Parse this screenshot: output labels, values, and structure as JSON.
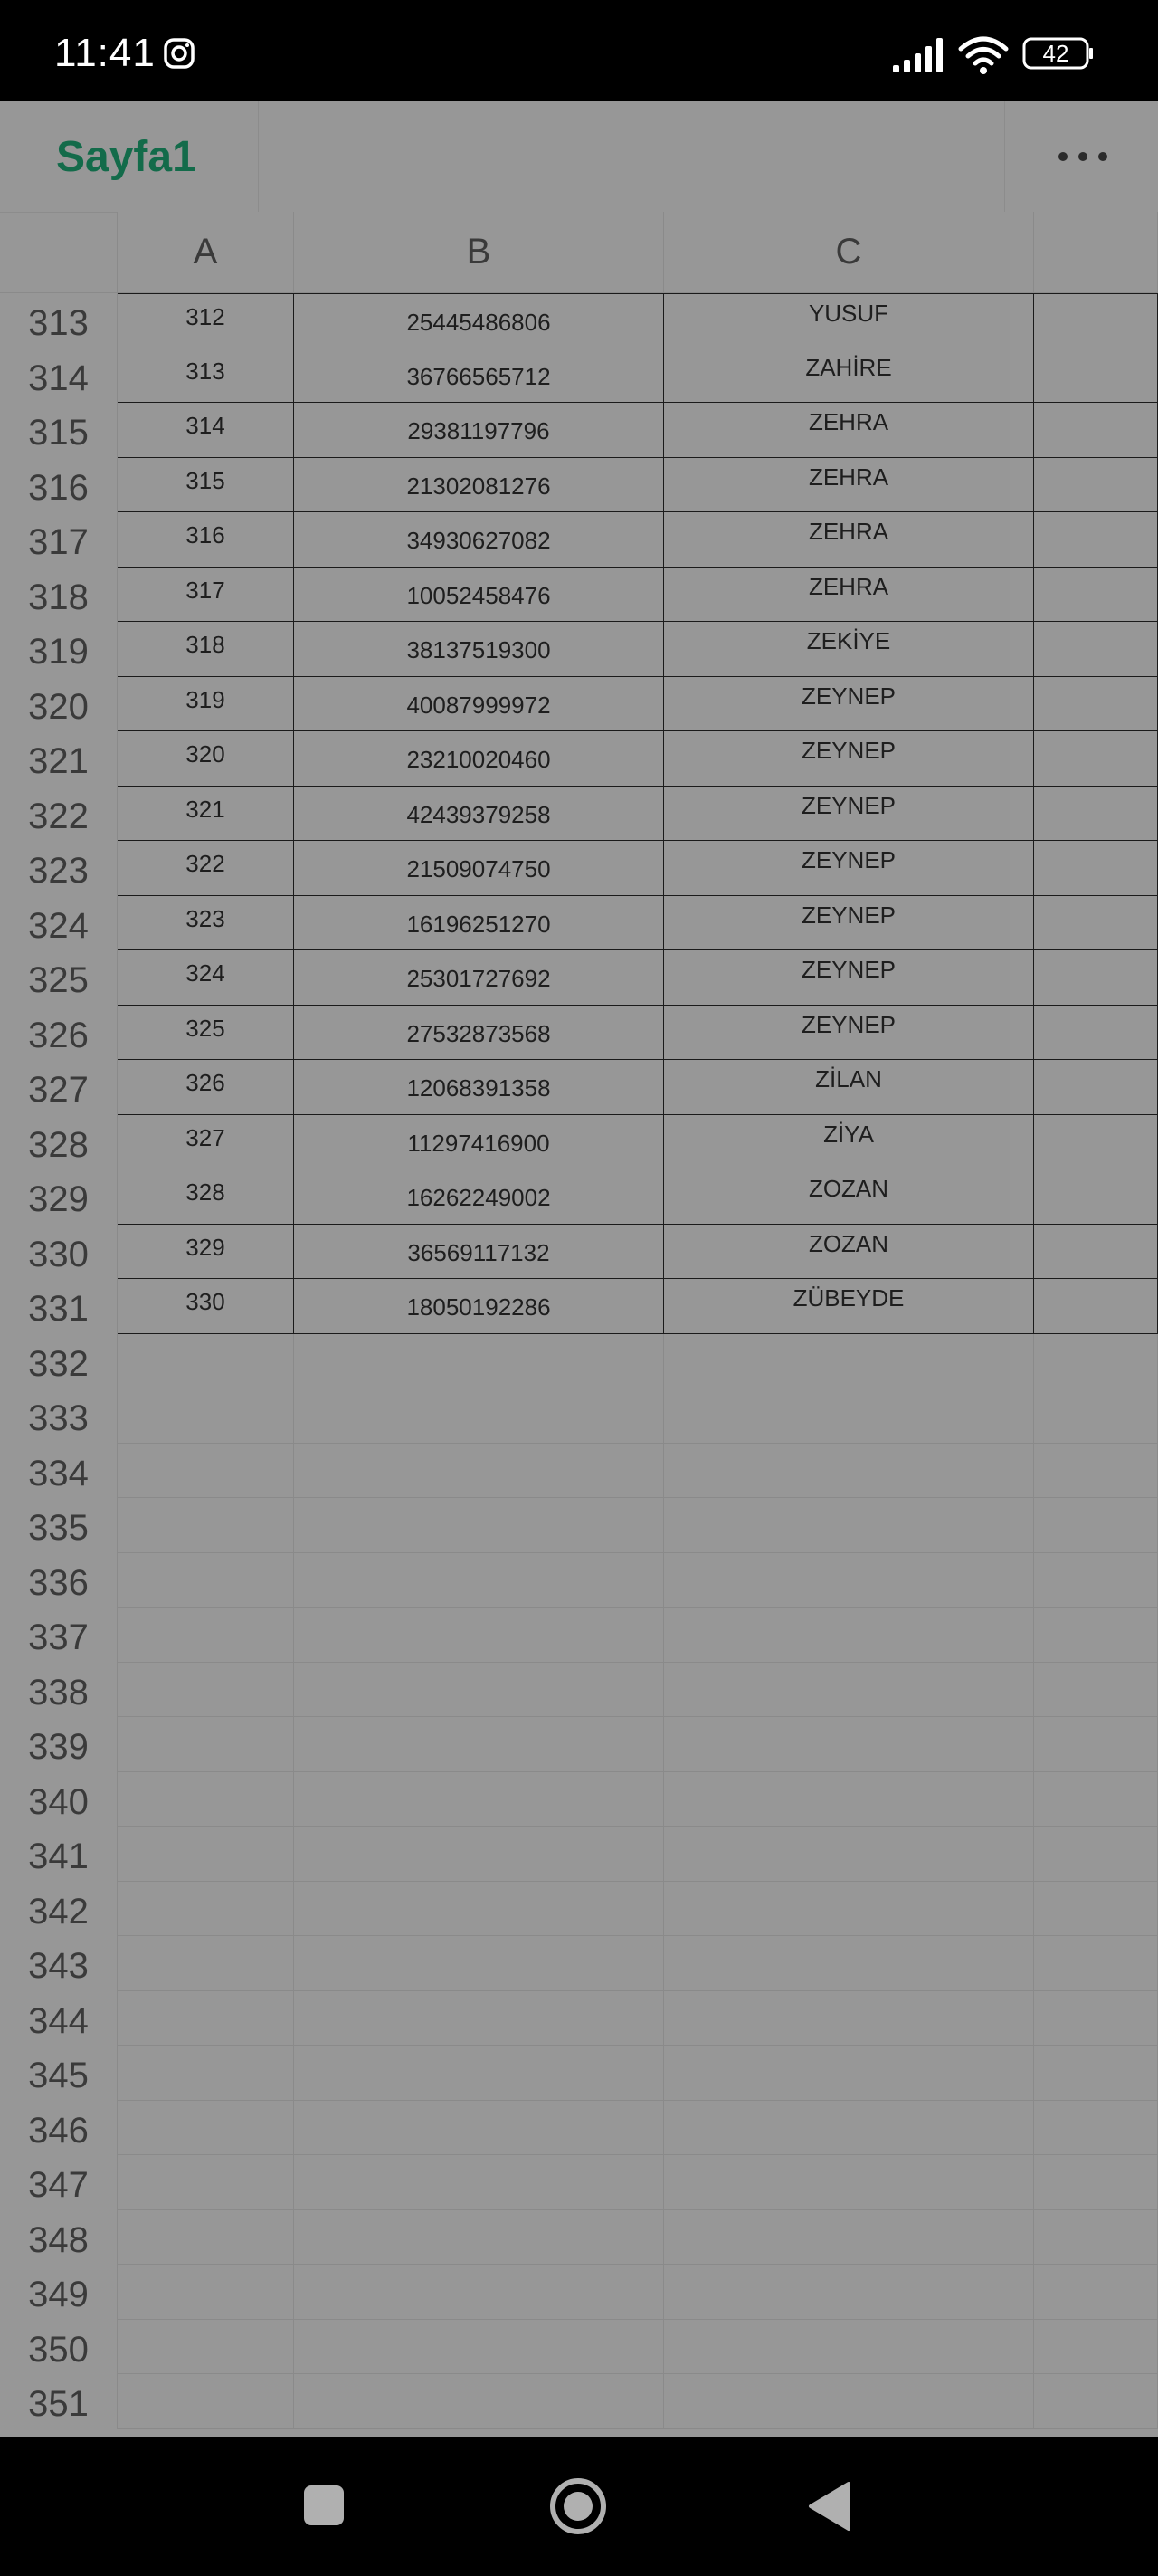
{
  "status_bar": {
    "time": "11:41",
    "battery": "42",
    "icons": [
      "instagram-icon",
      "signal-icon",
      "wifi-icon",
      "battery-icon"
    ]
  },
  "title_bar": {
    "sheet_name": "Sayfa1",
    "sheet_color": "#136b4a",
    "more_icon": "more-horizontal-icon"
  },
  "columns": [
    "A",
    "B",
    "C"
  ],
  "rows": [
    {
      "num": "313",
      "a": "312",
      "b": "25445486806",
      "c": "YUSUF"
    },
    {
      "num": "314",
      "a": "313",
      "b": "36766565712",
      "c": "ZAHİRE"
    },
    {
      "num": "315",
      "a": "314",
      "b": "29381197796",
      "c": "ZEHRA"
    },
    {
      "num": "316",
      "a": "315",
      "b": "21302081276",
      "c": "ZEHRA"
    },
    {
      "num": "317",
      "a": "316",
      "b": "34930627082",
      "c": "ZEHRA"
    },
    {
      "num": "318",
      "a": "317",
      "b": "10052458476",
      "c": "ZEHRA"
    },
    {
      "num": "319",
      "a": "318",
      "b": "38137519300",
      "c": "ZEKİYE"
    },
    {
      "num": "320",
      "a": "319",
      "b": "40087999972",
      "c": "ZEYNEP"
    },
    {
      "num": "321",
      "a": "320",
      "b": "23210020460",
      "c": "ZEYNEP"
    },
    {
      "num": "322",
      "a": "321",
      "b": "42439379258",
      "c": "ZEYNEP"
    },
    {
      "num": "323",
      "a": "322",
      "b": "21509074750",
      "c": "ZEYNEP"
    },
    {
      "num": "324",
      "a": "323",
      "b": "16196251270",
      "c": "ZEYNEP"
    },
    {
      "num": "325",
      "a": "324",
      "b": "25301727692",
      "c": "ZEYNEP"
    },
    {
      "num": "326",
      "a": "325",
      "b": "27532873568",
      "c": "ZEYNEP"
    },
    {
      "num": "327",
      "a": "326",
      "b": "12068391358",
      "c": "ZİLAN"
    },
    {
      "num": "328",
      "a": "327",
      "b": "11297416900",
      "c": "ZİYA"
    },
    {
      "num": "329",
      "a": "328",
      "b": "16262249002",
      "c": "ZOZAN"
    },
    {
      "num": "330",
      "a": "329",
      "b": "36569117132",
      "c": "ZOZAN"
    },
    {
      "num": "331",
      "a": "330",
      "b": "18050192286",
      "c": "ZÜBEYDE"
    }
  ],
  "empty_rows": [
    "332",
    "333",
    "334",
    "335",
    "336",
    "337",
    "338",
    "339",
    "340",
    "341",
    "342",
    "343",
    "344",
    "345",
    "346",
    "347",
    "348",
    "349",
    "350",
    "351"
  ],
  "nav_bar": {
    "icons": [
      "recents-icon",
      "home-icon",
      "back-icon"
    ]
  }
}
